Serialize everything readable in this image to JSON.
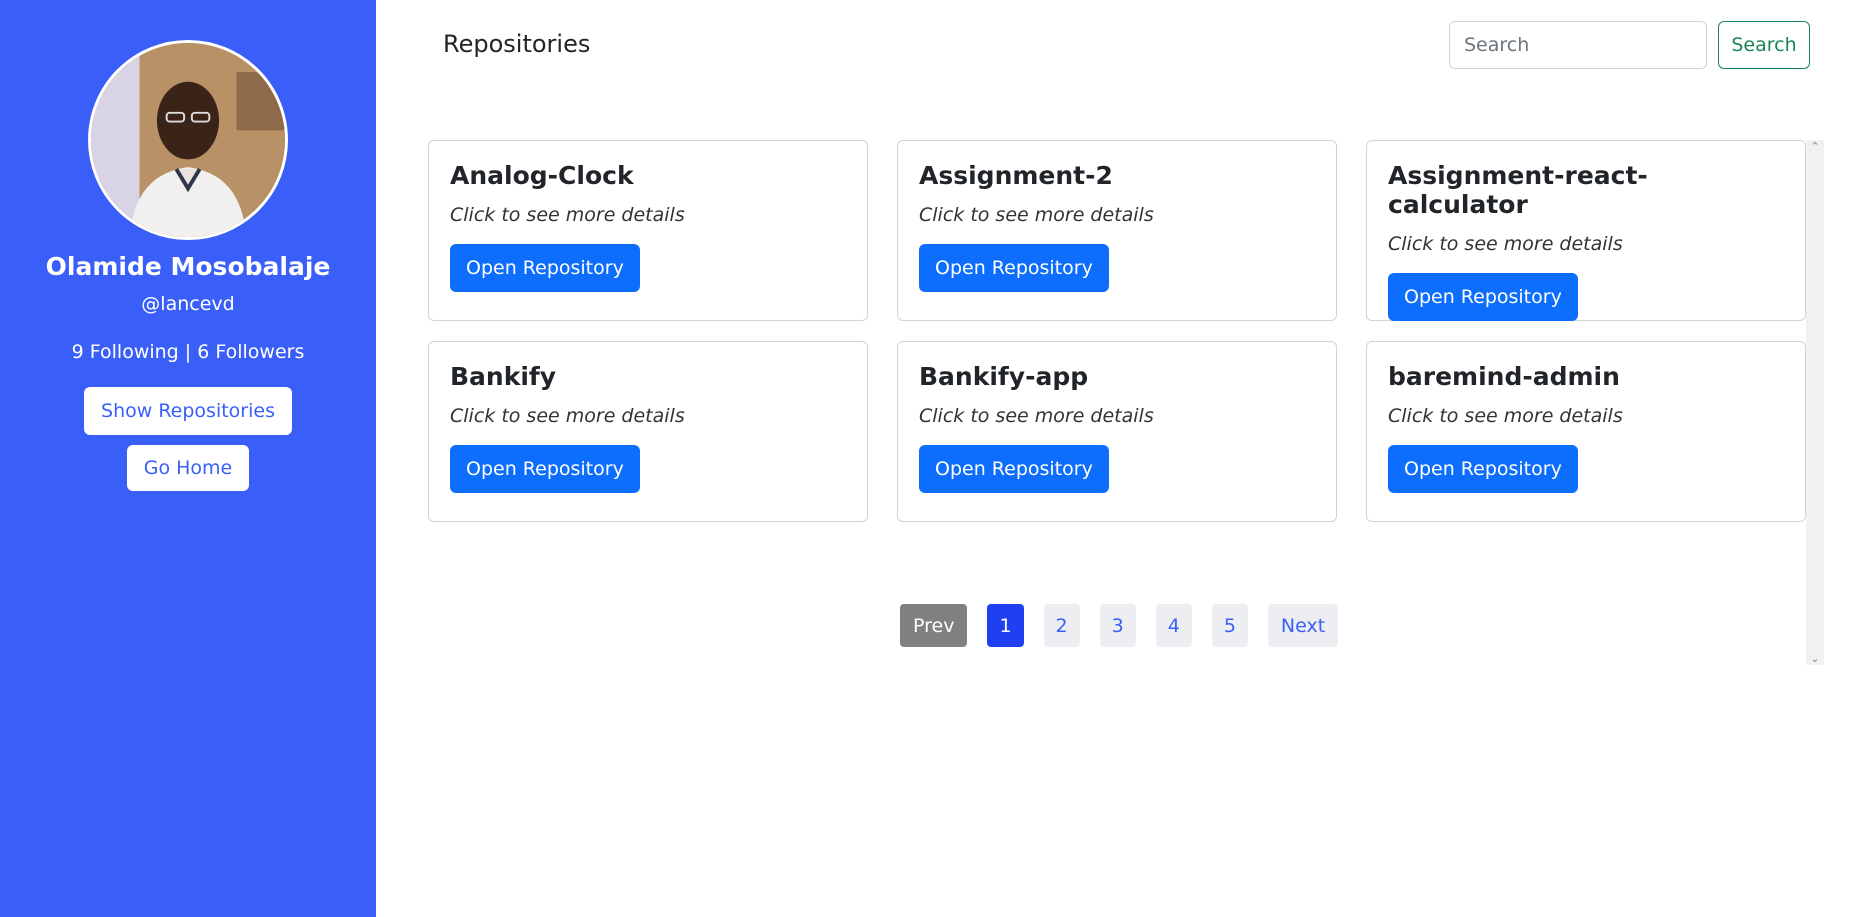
{
  "sidebar": {
    "profile_name": "Olamide Mosobalaje",
    "handle": "@lancevd",
    "stats": "9 Following | 6 Followers",
    "show_repos_label": "Show Repositories",
    "go_home_label": "Go Home"
  },
  "header": {
    "title": "Repositories",
    "search_placeholder": "Search",
    "search_button_label": "Search"
  },
  "repos": [
    {
      "name": "Analog-Clock",
      "subtitle": "Click to see more details",
      "button": "Open Repository"
    },
    {
      "name": "Assignment-2",
      "subtitle": "Click to see more details",
      "button": "Open Repository"
    },
    {
      "name": "Assignment-react-calculator",
      "subtitle": "Click to see more details",
      "button": "Open Repository"
    },
    {
      "name": "Bankify",
      "subtitle": "Click to see more details",
      "button": "Open Repository"
    },
    {
      "name": "Bankify-app",
      "subtitle": "Click to see more details",
      "button": "Open Repository"
    },
    {
      "name": "baremind-admin",
      "subtitle": "Click to see more details",
      "button": "Open Repository"
    }
  ],
  "pagination": {
    "prev": "Prev",
    "pages": [
      "1",
      "2",
      "3",
      "4",
      "5"
    ],
    "current": "1",
    "next": "Next"
  },
  "colors": {
    "sidebar_bg": "#3a5ff8",
    "primary_button": "#0d6efd",
    "search_accent": "#198754",
    "active_page": "#1f3ff0"
  }
}
